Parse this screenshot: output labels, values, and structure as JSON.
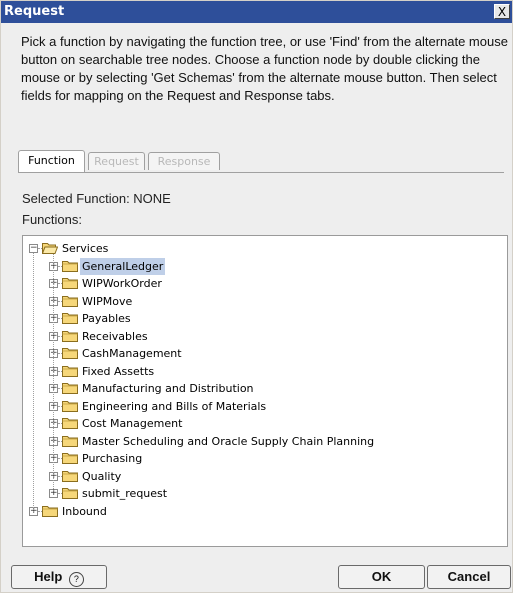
{
  "window": {
    "title": "Request",
    "close_label": "X"
  },
  "description": "Pick a function by navigating the function tree, or use 'Find' from the alternate mouse button on searchable tree nodes. Choose a function node by double clicking the mouse or by selecting 'Get Schemas' from the alternate mouse button. Then select fields for mapping on the Request and Response tabs.",
  "tabs": [
    {
      "label": "Function",
      "state": "active"
    },
    {
      "label": "Request",
      "state": "disabled"
    },
    {
      "label": "Response",
      "state": "disabled"
    }
  ],
  "selected_function": "Selected Function: NONE",
  "functions_label": "Functions:",
  "tree": {
    "root": "Services",
    "children": [
      "GeneralLedger",
      "WIPWorkOrder",
      "WIPMove",
      "Payables",
      "Receivables",
      "CashManagement",
      "Fixed Assetts",
      "Manufacturing and Distribution",
      "Engineering and Bills of Materials",
      "Cost Management",
      "Master Scheduling and Oracle Supply Chain Planning",
      "Purchasing",
      "Quality",
      "submit_request"
    ],
    "selected": "GeneralLedger",
    "second_root": "Inbound"
  },
  "buttons": {
    "help": "Help",
    "ok": "OK",
    "cancel": "Cancel"
  },
  "icons": {
    "help": "circled-question-icon",
    "folder": "folder-icon",
    "expand": "plus-expander-icon",
    "collapse": "minus-expander-icon"
  },
  "colors": {
    "titlebar": "#2e4f9a",
    "selection": "#bfcfe8",
    "folder": "#f6d77a"
  }
}
